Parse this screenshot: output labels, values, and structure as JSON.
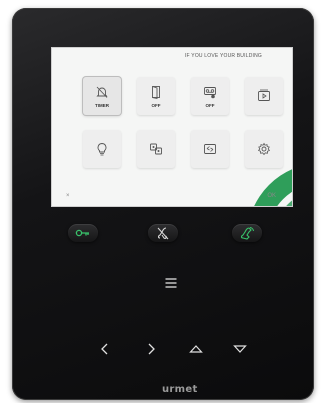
{
  "screen": {
    "title": "IF YOU LOVE YOUR BUILDING",
    "tiles": [
      {
        "icon": "bell-off-icon",
        "label": "TIMER"
      },
      {
        "icon": "door-icon",
        "label": "OFF"
      },
      {
        "icon": "voicemail-icon",
        "label": "OFF"
      },
      {
        "icon": "video-playback-icon",
        "label": ""
      },
      {
        "icon": "lightbulb-icon",
        "label": ""
      },
      {
        "icon": "intercom-icon",
        "label": ""
      },
      {
        "icon": "camera-switch-icon",
        "label": ""
      },
      {
        "icon": "settings-icon",
        "label": ""
      }
    ],
    "soft_left": "×",
    "soft_right": "OK"
  },
  "buttons": {
    "key": "key-icon",
    "mute": "mute-ring-icon",
    "answer": "handset-icon",
    "menu": "≡"
  },
  "brand": "urmet",
  "colors": {
    "accent_green": "#2f9e5a",
    "device_black": "#141416",
    "screen_bg": "#f5f6f5"
  }
}
